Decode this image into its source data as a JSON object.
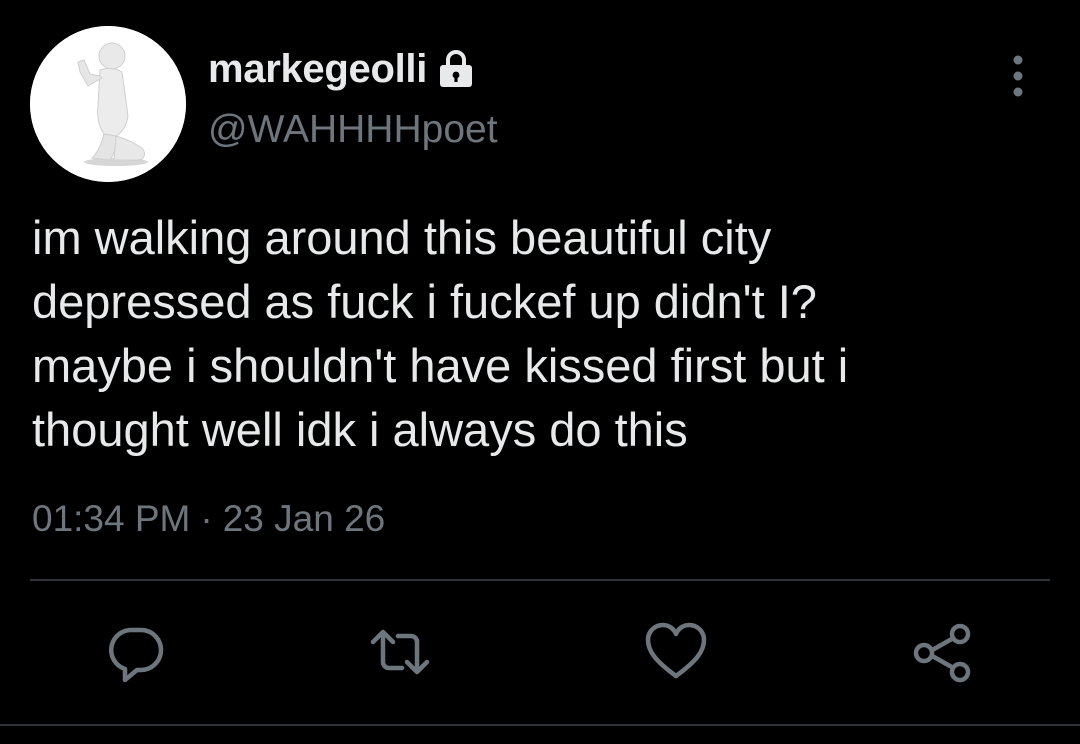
{
  "tweet": {
    "author": {
      "display_name": "markegeolli",
      "handle": "@WAHHHHpoet",
      "protected_icon": "lock-icon",
      "avatar": "praying-figure-avatar"
    },
    "text_lines": [
      "im walking around this beautiful city",
      "depressed as fuck i fuckef up didn't I?",
      "maybe i shouldn't have kissed first but i",
      "thought well idk i always do this"
    ],
    "time": "01:34 PM",
    "separator": "·",
    "date": "23 Jan 26",
    "menu_icon": "more-vertical-icon",
    "actions": {
      "reply_icon": "reply-icon",
      "retweet_icon": "retweet-icon",
      "like_icon": "heart-icon",
      "share_icon": "share-icon"
    }
  },
  "colors": {
    "background": "#000000",
    "primary_text": "#e7e9ea",
    "secondary_text": "#6e767d",
    "divider": "#2f3336"
  }
}
